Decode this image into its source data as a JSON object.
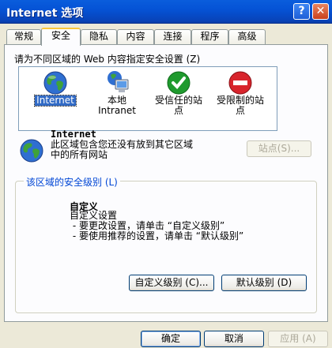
{
  "window": {
    "title": "Internet 选项",
    "help_label": "?",
    "close_label": "✕"
  },
  "tabs": [
    {
      "label": "常规"
    },
    {
      "label": "安全"
    },
    {
      "label": "隐私"
    },
    {
      "label": "内容"
    },
    {
      "label": "连接"
    },
    {
      "label": "程序"
    },
    {
      "label": "高级"
    }
  ],
  "security": {
    "instruction": "请为不同区域的 Web 内容指定安全设置 (Z)",
    "zones": [
      {
        "name": "Internet",
        "icon": "globe-icon",
        "selected": true
      },
      {
        "name": "本地\nIntranet",
        "icon": "intranet-computer-icon",
        "selected": false
      },
      {
        "name": "受信任的站\n点",
        "icon": "trusted-check-icon",
        "selected": false
      },
      {
        "name": "受限制的站\n点",
        "icon": "restricted-no-entry-icon",
        "selected": false
      }
    ],
    "zone_info": {
      "name": "Internet",
      "description": "此区域包含您还没有放到其它区域\n中的所有网站"
    },
    "sites_button": "站点(S)...",
    "level_group": {
      "legend": "该区域的安全级别 (L)",
      "title": "自定义",
      "lines": [
        "自定义设置",
        " - 要更改设置，请单击 “自定义级别”",
        " - 要使用推荐的设置，请单击 “默认级别”"
      ],
      "custom_level_button": "自定义级别 (C)...",
      "default_level_button": "默认级别 (D)"
    }
  },
  "footer": {
    "ok": "确定",
    "cancel": "取消",
    "apply": "应用 (A)"
  },
  "colors": {
    "titlebar": "#0553d6",
    "selection": "#316ac5",
    "group_legend": "#0046d5",
    "tab_active_accent": "#fac63a"
  }
}
